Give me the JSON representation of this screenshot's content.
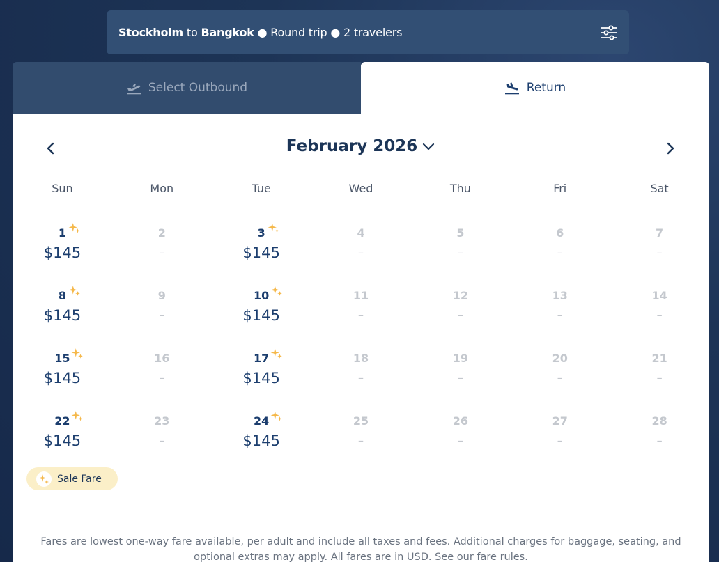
{
  "search": {
    "origin": "Stockholm",
    "to_word": " to ",
    "destination": "Bangkok",
    "trip_type": " ● Round trip ● 2 travelers",
    "filter_icon": "sliders-icon"
  },
  "tabs": {
    "outbound_label": "Select Outbound",
    "return_label": "Return",
    "active": "return"
  },
  "calendar": {
    "month_label": "February 2026",
    "weekdays": [
      "Sun",
      "Mon",
      "Tue",
      "Wed",
      "Thu",
      "Fri",
      "Sat"
    ],
    "weeks": [
      [
        {
          "day": "1",
          "price": "$145",
          "sale": true
        },
        {
          "day": "2",
          "price": "–",
          "sale": false
        },
        {
          "day": "3",
          "price": "$145",
          "sale": true
        },
        {
          "day": "4",
          "price": "–",
          "sale": false
        },
        {
          "day": "5",
          "price": "–",
          "sale": false
        },
        {
          "day": "6",
          "price": "–",
          "sale": false
        },
        {
          "day": "7",
          "price": "–",
          "sale": false
        }
      ],
      [
        {
          "day": "8",
          "price": "$145",
          "sale": true
        },
        {
          "day": "9",
          "price": "–",
          "sale": false
        },
        {
          "day": "10",
          "price": "$145",
          "sale": true
        },
        {
          "day": "11",
          "price": "–",
          "sale": false
        },
        {
          "day": "12",
          "price": "–",
          "sale": false
        },
        {
          "day": "13",
          "price": "–",
          "sale": false
        },
        {
          "day": "14",
          "price": "–",
          "sale": false
        }
      ],
      [
        {
          "day": "15",
          "price": "$145",
          "sale": true
        },
        {
          "day": "16",
          "price": "–",
          "sale": false
        },
        {
          "day": "17",
          "price": "$145",
          "sale": true
        },
        {
          "day": "18",
          "price": "–",
          "sale": false
        },
        {
          "day": "19",
          "price": "–",
          "sale": false
        },
        {
          "day": "20",
          "price": "–",
          "sale": false
        },
        {
          "day": "21",
          "price": "–",
          "sale": false
        }
      ],
      [
        {
          "day": "22",
          "price": "$145",
          "sale": true
        },
        {
          "day": "23",
          "price": "–",
          "sale": false
        },
        {
          "day": "24",
          "price": "$145",
          "sale": true
        },
        {
          "day": "25",
          "price": "–",
          "sale": false
        },
        {
          "day": "26",
          "price": "–",
          "sale": false
        },
        {
          "day": "27",
          "price": "–",
          "sale": false
        },
        {
          "day": "28",
          "price": "–",
          "sale": false
        }
      ]
    ]
  },
  "legend": {
    "label": "Sale Fare"
  },
  "disclaimer": {
    "text": "Fares are lowest one-way fare available, per adult and include all taxes and fees. Additional charges for baggage, seating, and optional extras may apply. All fares are in USD. See our ",
    "link": "fare rules",
    "end": "."
  },
  "colors": {
    "background": "#1d3456",
    "accent": "#1c3e6e",
    "sale_sparkle": "#f5b84a",
    "legend_bg": "#fbefc8"
  }
}
